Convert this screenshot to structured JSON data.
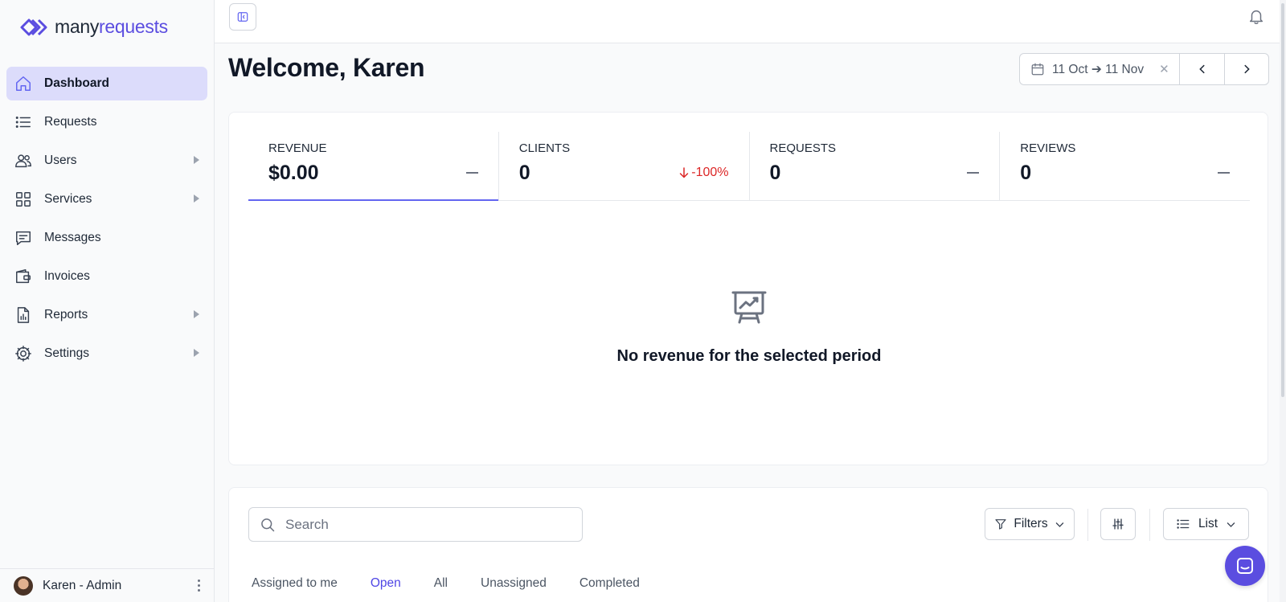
{
  "brand": {
    "part1": "many",
    "part2": "requests"
  },
  "sidebar": {
    "items": [
      {
        "label": "Dashboard",
        "icon": "home-icon",
        "active": true,
        "expandable": false
      },
      {
        "label": "Requests",
        "icon": "list-icon",
        "active": false,
        "expandable": false
      },
      {
        "label": "Users",
        "icon": "users-icon",
        "active": false,
        "expandable": true
      },
      {
        "label": "Services",
        "icon": "grid-icon",
        "active": false,
        "expandable": true
      },
      {
        "label": "Messages",
        "icon": "chat-icon",
        "active": false,
        "expandable": false
      },
      {
        "label": "Invoices",
        "icon": "wallet-icon",
        "active": false,
        "expandable": false
      },
      {
        "label": "Reports",
        "icon": "report-icon",
        "active": false,
        "expandable": true
      },
      {
        "label": "Settings",
        "icon": "gear-icon",
        "active": false,
        "expandable": true
      }
    ],
    "user": {
      "name": "Karen - Admin"
    }
  },
  "header": {
    "welcome": "Welcome, Karen",
    "date_range": "11 Oct ➔ 11 Nov"
  },
  "stats": [
    {
      "label": "REVENUE",
      "value": "$0.00",
      "change": null
    },
    {
      "label": "CLIENTS",
      "value": "0",
      "change": "-100%"
    },
    {
      "label": "REQUESTS",
      "value": "0",
      "change": null
    },
    {
      "label": "REVIEWS",
      "value": "0",
      "change": null
    }
  ],
  "empty_state": {
    "message": "No revenue for the selected period"
  },
  "requests": {
    "search_placeholder": "Search",
    "filters_label": "Filters",
    "view_label": "List",
    "tabs": [
      "Assigned to me",
      "Open",
      "All",
      "Unassigned",
      "Completed"
    ],
    "active_tab": "Open"
  },
  "colors": {
    "accent": "#5b4de0",
    "active_nav_bg": "#dcdcfb",
    "negative": "#dc2626",
    "tab_active": "#4f46e5"
  }
}
